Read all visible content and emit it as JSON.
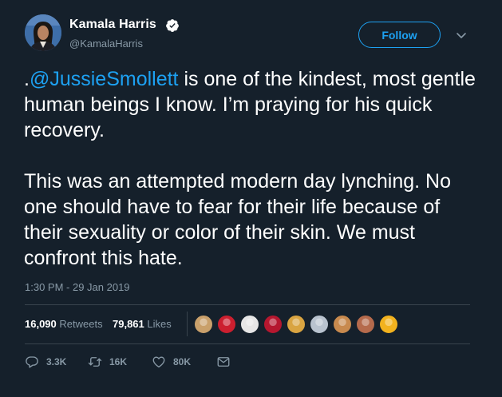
{
  "user": {
    "display_name": "Kamala Harris",
    "handle": "@KamalaHarris",
    "verified": true
  },
  "follow_label": "Follow",
  "tweet": {
    "lead": ".",
    "mention": "@JussieSmollett",
    "body": " is one of the kindest, most gentle human beings I know. I’m praying for his quick recovery.\n\nThis was an attempted modern day lynching. No one should have to fear for their life because of their sexuality or color of their skin. We must confront this hate."
  },
  "timestamp": "1:30 PM - 29 Jan 2019",
  "stats": {
    "retweets_count": "16,090",
    "retweets_label": "Retweets",
    "likes_count": "79,861",
    "likes_label": "Likes"
  },
  "liker_avatars": [
    "#c9a06b",
    "#cc1f2f",
    "#e6e6e6",
    "#b5172f",
    "#d9a441",
    "#b9c3cf",
    "#c88a4e",
    "#b56a4c",
    "#f2b21e"
  ],
  "actions": {
    "reply_count": "3.3K",
    "retweet_count": "16K",
    "like_count": "80K"
  },
  "colors": {
    "background": "#15202b",
    "accent": "#1da1f2",
    "secondary_text": "#8899a6",
    "divider": "#38444d"
  }
}
